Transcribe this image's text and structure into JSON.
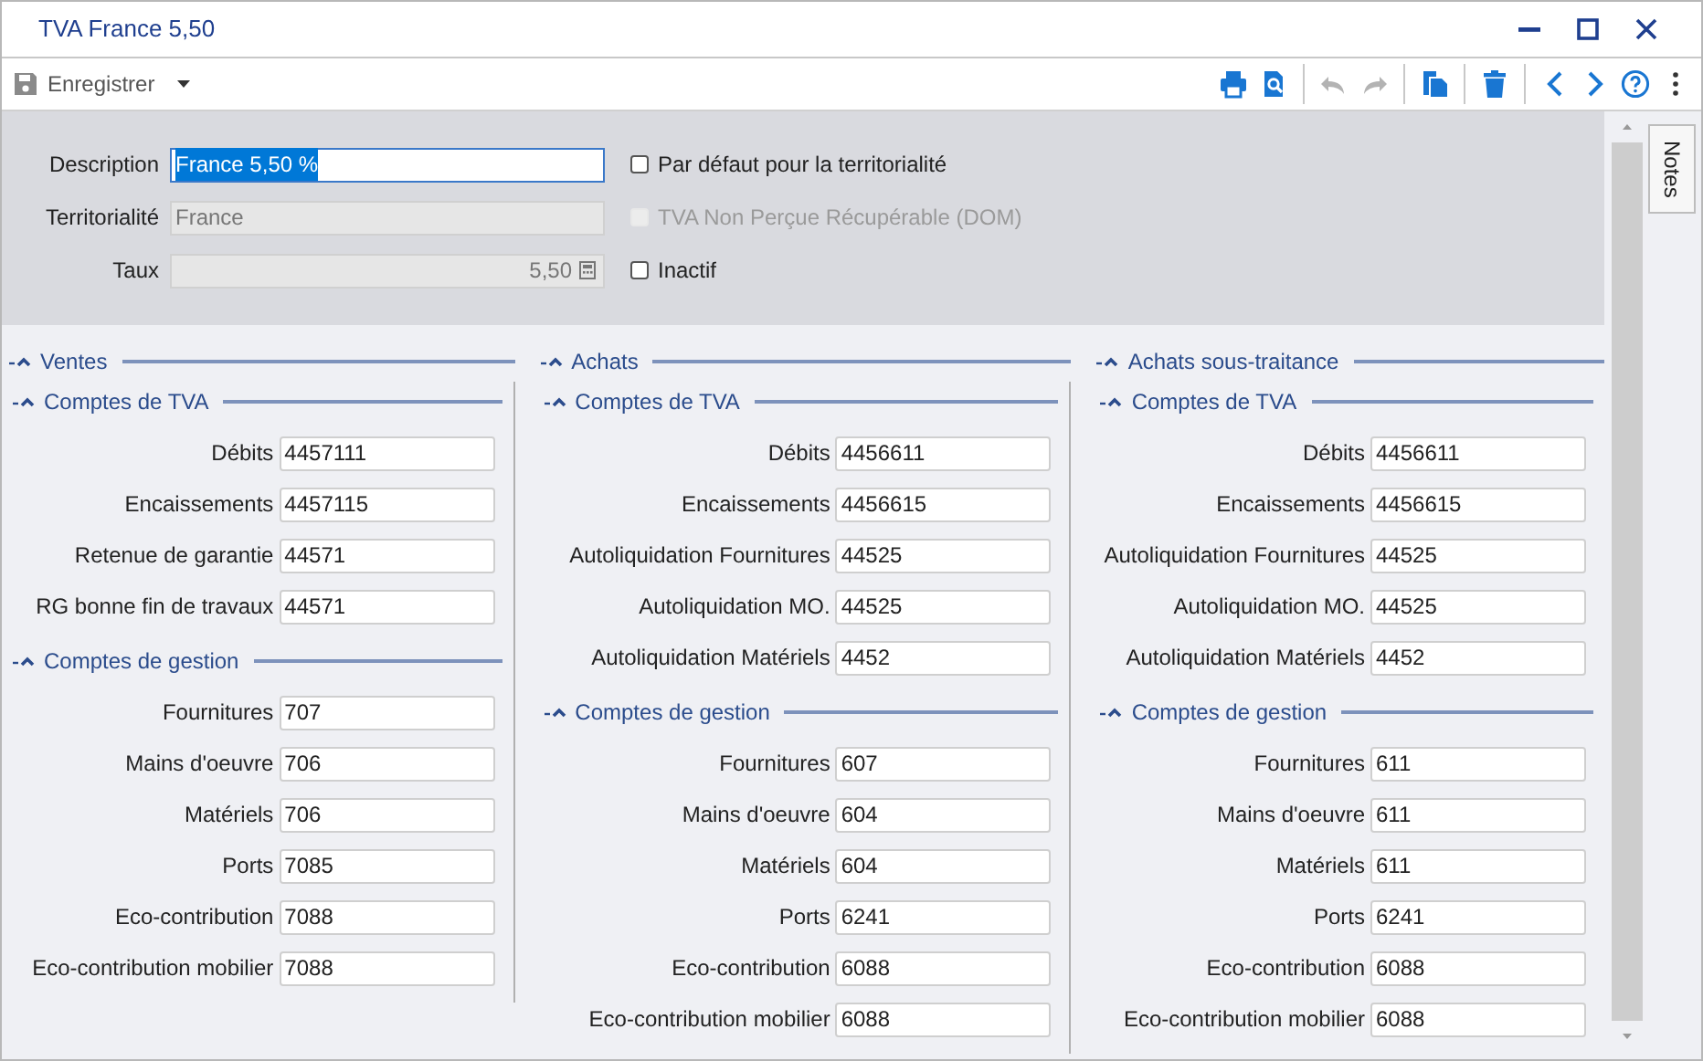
{
  "window": {
    "title": "TVA France 5,50"
  },
  "toolbar": {
    "save": {
      "label": "Enregistrer",
      "disabled": true
    },
    "tools": [
      {
        "kind": "print",
        "disabled": false
      },
      {
        "kind": "preview",
        "disabled": false
      },
      {
        "kind": "separator"
      },
      {
        "kind": "undo",
        "disabled": true
      },
      {
        "kind": "redo",
        "disabled": true
      },
      {
        "kind": "separator"
      },
      {
        "kind": "copy",
        "disabled": false
      },
      {
        "kind": "separator"
      },
      {
        "kind": "delete",
        "disabled": false
      },
      {
        "kind": "separator"
      },
      {
        "kind": "prev",
        "disabled": false
      },
      {
        "kind": "next",
        "disabled": false
      },
      {
        "kind": "help",
        "disabled": false
      },
      {
        "kind": "more",
        "disabled": false
      }
    ]
  },
  "header": {
    "fields": [
      {
        "label": "Description",
        "value": "France 5,50 %",
        "disabled": false,
        "selected": true
      },
      {
        "label": "Territorialité",
        "value": "France",
        "disabled": true,
        "selected": false
      },
      {
        "label": "Taux",
        "value": "5,50",
        "disabled": true,
        "selected": false,
        "kind": "number"
      }
    ],
    "checkboxes": [
      {
        "label": "Par défaut pour la territorialité",
        "checked": false,
        "disabled": false
      },
      {
        "label": "TVA Non Perçue Récupérable (DOM)",
        "checked": false,
        "disabled": true
      },
      {
        "label": "Inactif",
        "checked": false,
        "disabled": false
      }
    ]
  },
  "sections": [
    {
      "title": "Ventes",
      "expanded": true,
      "groups": [
        {
          "title": "Comptes de TVA",
          "expanded": true,
          "rows": [
            {
              "label": "Débits",
              "value": "4457111"
            },
            {
              "label": "Encaissements",
              "value": "4457115"
            },
            {
              "label": "Retenue de garantie",
              "value": "44571"
            },
            {
              "label": "RG bonne fin de travaux",
              "value": "44571"
            }
          ]
        },
        {
          "title": "Comptes de gestion",
          "expanded": true,
          "rows": [
            {
              "label": "Fournitures",
              "value": "707"
            },
            {
              "label": "Mains d'oeuvre",
              "value": "706"
            },
            {
              "label": "Matériels",
              "value": "706"
            },
            {
              "label": "Ports",
              "value": "7085"
            },
            {
              "label": "Eco-contribution",
              "value": "7088"
            },
            {
              "label": "Eco-contribution mobilier",
              "value": "7088"
            }
          ]
        }
      ]
    },
    {
      "title": "Achats",
      "expanded": true,
      "groups": [
        {
          "title": "Comptes de TVA",
          "expanded": true,
          "rows": [
            {
              "label": "Débits",
              "value": "4456611"
            },
            {
              "label": "Encaissements",
              "value": "4456615"
            },
            {
              "label": "Autoliquidation Fournitures",
              "value": "44525"
            },
            {
              "label": "Autoliquidation MO.",
              "value": "44525"
            },
            {
              "label": "Autoliquidation Matériels",
              "value": "4452"
            }
          ]
        },
        {
          "title": "Comptes de gestion",
          "expanded": true,
          "rows": [
            {
              "label": "Fournitures",
              "value": "607"
            },
            {
              "label": "Mains d'oeuvre",
              "value": "604"
            },
            {
              "label": "Matériels",
              "value": "604"
            },
            {
              "label": "Ports",
              "value": "6241"
            },
            {
              "label": "Eco-contribution",
              "value": "6088"
            },
            {
              "label": "Eco-contribution mobilier",
              "value": "6088"
            }
          ]
        }
      ]
    },
    {
      "title": "Achats sous-traitance",
      "expanded": true,
      "groups": [
        {
          "title": "Comptes de TVA",
          "expanded": true,
          "rows": [
            {
              "label": "Débits",
              "value": "4456611"
            },
            {
              "label": "Encaissements",
              "value": "4456615"
            },
            {
              "label": "Autoliquidation Fournitures",
              "value": "44525"
            },
            {
              "label": "Autoliquidation MO.",
              "value": "44525"
            },
            {
              "label": "Autoliquidation Matériels",
              "value": "4452"
            }
          ]
        },
        {
          "title": "Comptes de gestion",
          "expanded": true,
          "rows": [
            {
              "label": "Fournitures",
              "value": "611"
            },
            {
              "label": "Mains d'oeuvre",
              "value": "611"
            },
            {
              "label": "Matériels",
              "value": "611"
            },
            {
              "label": "Ports",
              "value": "6241"
            },
            {
              "label": "Eco-contribution",
              "value": "6088"
            },
            {
              "label": "Eco-contribution mobilier",
              "value": "6088"
            }
          ]
        }
      ]
    }
  ],
  "side_tabs": [
    {
      "label": "Notes",
      "selected": false
    }
  ]
}
